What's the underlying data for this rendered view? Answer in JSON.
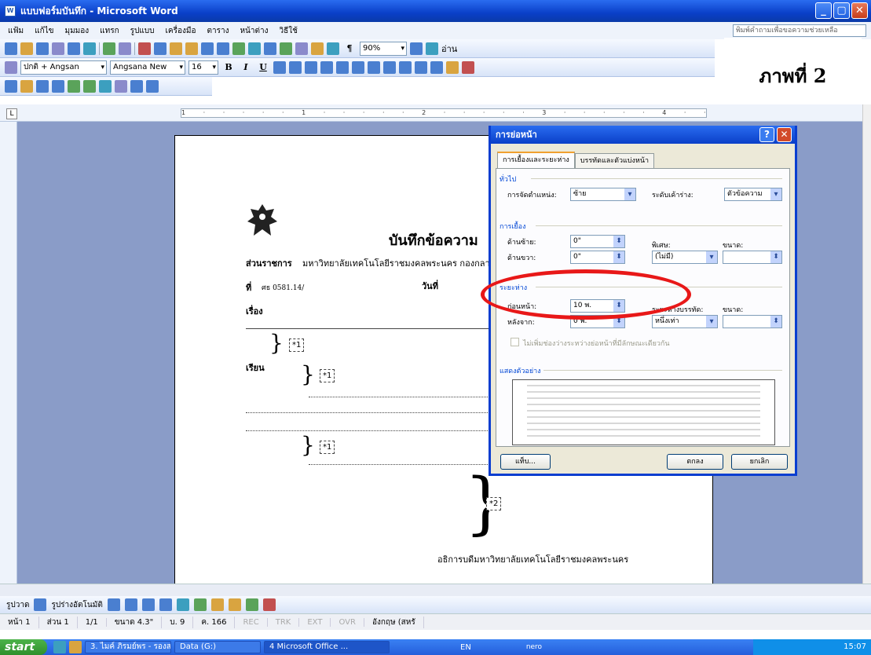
{
  "window": {
    "title": "แบบฟอร์มบันทึก - Microsoft Word",
    "min": "_",
    "max": "▢",
    "close": "✕"
  },
  "menu": {
    "items": [
      "แฟ้ม",
      "แก้ไข",
      "มุมมอง",
      "แทรก",
      "รูปแบบ",
      "เครื่องมือ",
      "ตาราง",
      "หน้าต่าง",
      "วิธีใช้"
    ],
    "help_placeholder": "พิมพ์คำถามเพื่อขอความช่วยเหลือ"
  },
  "toolbar": {
    "zoom": "90%",
    "read_label": "อ่าน",
    "style": "ปกติ + Angsan",
    "font": "Angsana New",
    "size": "16",
    "bold": "B",
    "italic": "I",
    "underline": "U",
    "pilcrow": "¶"
  },
  "annotation": {
    "label": "ภาพที่ 2"
  },
  "ruler": {
    "corner": "L",
    "ticks": "1 · · · · · 1 · · · · · 2 · · · · · 3 · · · · · 4 · · · · · 5 · · · · · 6 · · · · · 7"
  },
  "document": {
    "heading": "บันทึกข้อความ",
    "agency_label": "ส่วนราชการ",
    "agency_value": "มหาวิทยาลัยเทคโนโลยีราชมงคลพระนคร กองกลาง",
    "ref_label": "ที่",
    "ref_value": "ศธ 0581.14/",
    "date_label": "วันที่",
    "subject_label": "เรื่อง",
    "to_label": "เรียน",
    "marker1": "*1",
    "marker2": "*2",
    "signature": "อธิการบดีมหาวิทยาลัยเทคโนโลยีราชมงคลพระนคร"
  },
  "dialog": {
    "title": "การย่อหน้า",
    "help": "?",
    "close": "✕",
    "tabs": [
      "การเยื้องและระยะห่าง",
      "บรรทัดและตัวแบ่งหน้า"
    ],
    "general": {
      "section": "ทั่วไป",
      "alignment_label": "การจัดตำแหน่ง:",
      "alignment_value": "ซ้าย",
      "outline_label": "ระดับเค้าร่าง:",
      "outline_value": "ตัวข้อความ"
    },
    "indent": {
      "section": "การเยื้อง",
      "left_label": "ด้านซ้าย:",
      "left_value": "0\"",
      "right_label": "ด้านขวา:",
      "right_value": "0\"",
      "special_label": "พิเศษ:",
      "special_value": "(ไม่มี)",
      "by_label": "ขนาด:",
      "by_value": ""
    },
    "spacing": {
      "section": "ระยะห่าง",
      "before_label": "ก่อนหน้า:",
      "before_value": "10 พ.",
      "after_label": "หลังจาก:",
      "after_value": "0 พ.",
      "line_label": "ระยะห่างบรรทัด:",
      "line_value": "หนึ่งเท่า",
      "at_label": "ขนาด:",
      "at_value": "",
      "nospace_label": "ไม่เพิ่มช่องว่างระหว่างย่อหน้าที่มีลักษณะเดียวกัน"
    },
    "preview": {
      "section": "แสดงตัวอย่าง"
    },
    "buttons": {
      "tabs": "แท็บ...",
      "ok": "ตกลง",
      "cancel": "ยกเลิก"
    }
  },
  "drawbar": {
    "draw": "รูปวาด",
    "autoshapes": "รูปร่างอัตโนมัติ"
  },
  "status": {
    "page": "หน้า 1",
    "section": "ส่วน 1",
    "pages": "1/1",
    "at": "ขนาด 4.3\"",
    "line": "บ. 9",
    "col": "ค. 166",
    "rec": "REC",
    "trk": "TRK",
    "ext": "EXT",
    "ovr": "OVR",
    "lang": "อังกฤษ (สหรั"
  },
  "taskbar": {
    "start": "start",
    "tasks": [
      "3. ไมค์ ภิรมย์พร - รองส...",
      "Data (G:)",
      "4 Microsoft Office ..."
    ],
    "lang": "EN",
    "nero": "nero",
    "clock": "15:07"
  },
  "colors": {
    "title_blue": "#0a3fc8",
    "ring": "#e81818",
    "doc_bg": "#8a9cc8"
  }
}
